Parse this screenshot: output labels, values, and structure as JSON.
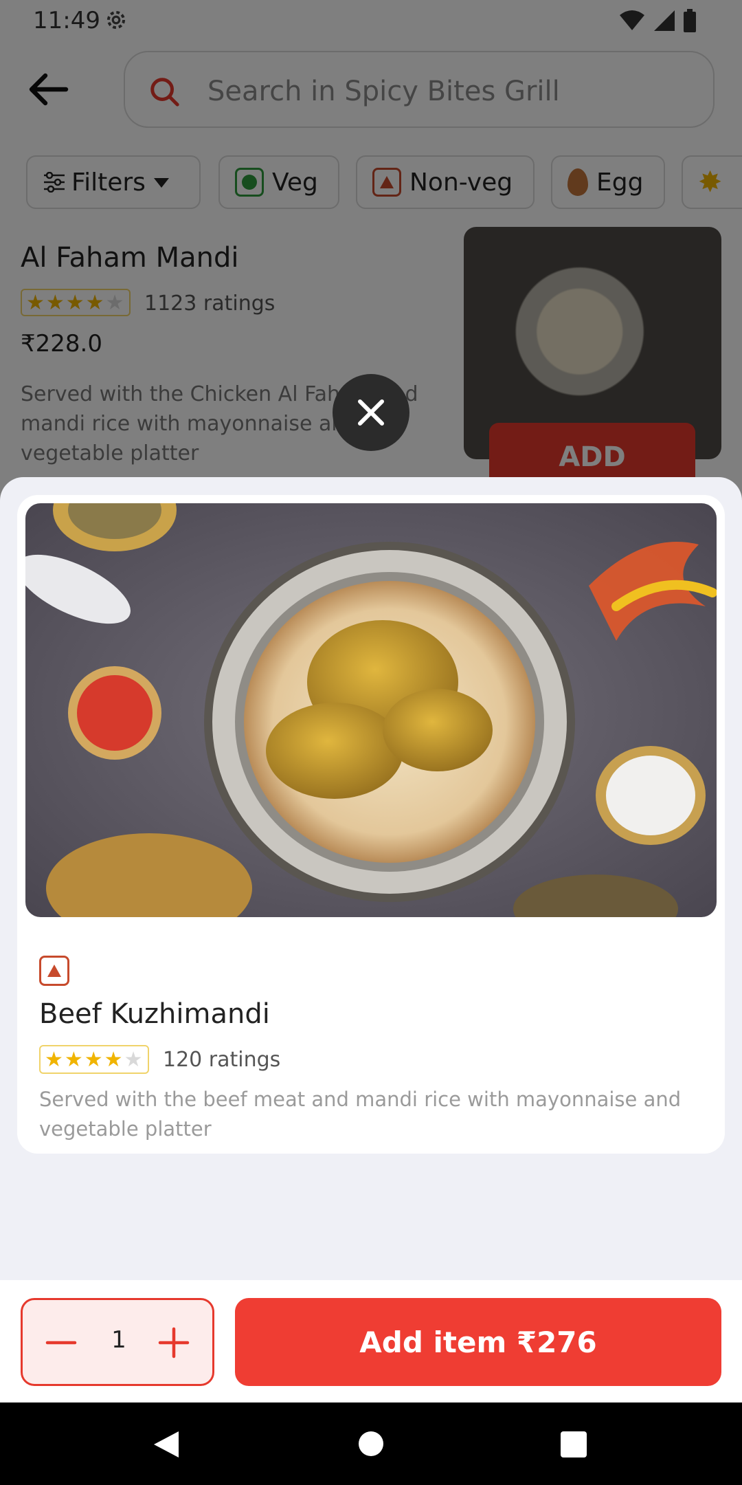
{
  "status_bar": {
    "time": "11:49"
  },
  "header": {
    "search_placeholder": "Search in Spicy Bites Grill"
  },
  "filters": {
    "filters_label": "Filters",
    "veg_label": "Veg",
    "nonveg_label": "Non-veg",
    "egg_label": "Egg"
  },
  "background_item": {
    "name": "Al Faham Mandi",
    "rating_stars": 4,
    "ratings_count": "1123 ratings",
    "price": "₹228.0",
    "description": "Served with the Chicken Al Faham and mandi rice with mayonnaise and vegetable platter",
    "add_label": "ADD"
  },
  "item": {
    "name": "Beef Kuzhimandi",
    "rating_stars": 4,
    "ratings_count": "120 ratings",
    "description": "Served with the beef meat and mandi rice with mayonnaise and vegetable platter",
    "type": "non-veg"
  },
  "footer": {
    "quantity": "1",
    "add_item_label": "Add item ₹276"
  },
  "colors": {
    "accent": "#ef3d33",
    "veg": "#2e9b3c",
    "nonveg": "#c74a2c",
    "star": "#f0b400"
  },
  "icons": {
    "back": "arrow-left-icon",
    "search": "search-icon",
    "close": "close-icon",
    "minus": "minus-icon",
    "plus": "plus-icon"
  }
}
